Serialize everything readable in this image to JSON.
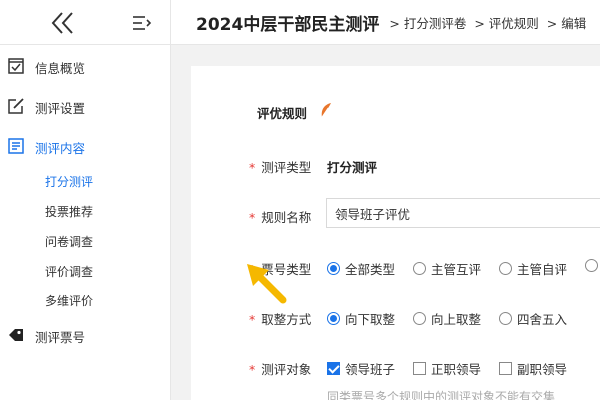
{
  "sidebar": {
    "items": [
      {
        "label": "信息概览",
        "icon": "checklist-icon"
      },
      {
        "label": "测评设置",
        "icon": "edit-icon"
      },
      {
        "label": "测评内容",
        "icon": "list-icon"
      },
      {
        "label": "测评票号",
        "icon": "tag-icon"
      }
    ],
    "sub_items": [
      "打分测评",
      "投票推荐",
      "问卷调查",
      "评价调查",
      "多维评价"
    ]
  },
  "header": {
    "title": "2024中层干部民主测评",
    "breadcrumbs": [
      "打分测评卷",
      "评优规则",
      "编辑"
    ],
    "separator": ">"
  },
  "form": {
    "section_title": "评优规则",
    "required_mark": "*",
    "eval_type": {
      "label": "测评类型",
      "value": "打分测评"
    },
    "rule_name": {
      "label": "规则名称",
      "value": "领导班子评优"
    },
    "ticket_type": {
      "label": "票号类型",
      "options": [
        "全部类型",
        "主管互评",
        "主管自评"
      ],
      "selected": 0
    },
    "rounding": {
      "label": "取整方式",
      "options": [
        "向下取整",
        "向上取整",
        "四舍五入"
      ],
      "selected": 0
    },
    "eval_target": {
      "label": "测评对象",
      "options": [
        "领导班子",
        "正职领导",
        "副职领导"
      ],
      "checked": [
        0
      ]
    },
    "hint": "同类票号多个规则中的测评对象不能有交集"
  },
  "colors": {
    "accent": "#1a73e8",
    "required": "#e53935",
    "arrow": "#f5b800"
  }
}
